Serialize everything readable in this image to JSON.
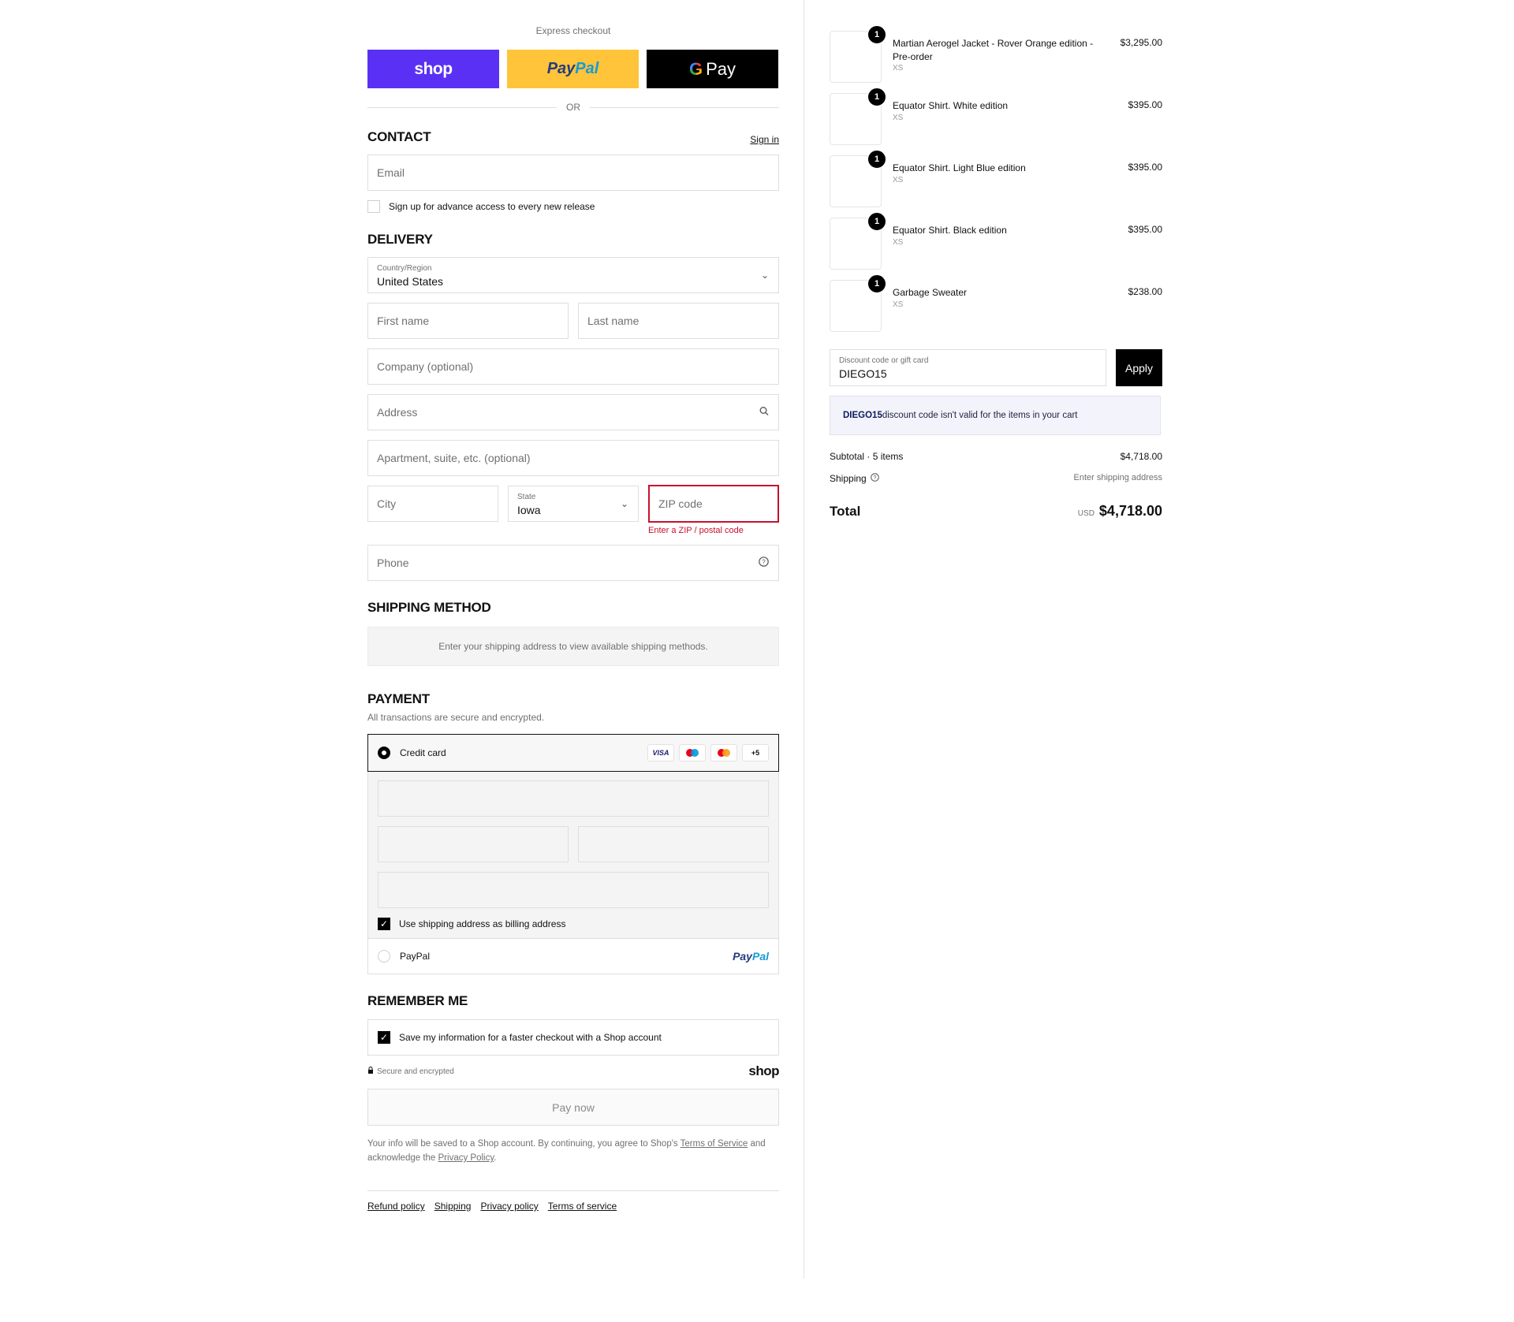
{
  "express": {
    "label": "Express checkout",
    "shop_label": "shop",
    "paypal_part1": "Pay",
    "paypal_part2": "Pal",
    "gpay_g": "G",
    "gpay_label": "Pay",
    "or_label": "OR"
  },
  "contact": {
    "heading": "CONTACT",
    "sign_in": "Sign in",
    "email_placeholder": "Email",
    "newsletter_label": "Sign up for advance access to every new release",
    "newsletter_checked": false
  },
  "delivery": {
    "heading": "DELIVERY",
    "country_label": "Country/Region",
    "country_value": "United States",
    "first_name_placeholder": "First name",
    "last_name_placeholder": "Last name",
    "company_placeholder": "Company (optional)",
    "address_placeholder": "Address",
    "apartment_placeholder": "Apartment, suite, etc. (optional)",
    "city_placeholder": "City",
    "state_label": "State",
    "state_value": "Iowa",
    "zip_placeholder": "ZIP code",
    "zip_error": "Enter a ZIP / postal code",
    "phone_placeholder": "Phone"
  },
  "shipping_method": {
    "heading": "SHIPPING METHOD",
    "notice": "Enter your shipping address to view available shipping methods."
  },
  "payment": {
    "heading": "PAYMENT",
    "subtitle": "All transactions are secure and encrypted.",
    "credit_card_label": "Credit card",
    "card_badges": [
      "VISA",
      "maestro",
      "mastercard",
      "+5"
    ],
    "billing_same_label": "Use shipping address as billing address",
    "billing_same_checked": true,
    "paypal_label": "PayPal",
    "paypal_logo_part1": "Pay",
    "paypal_logo_part2": "Pal"
  },
  "remember": {
    "heading": "REMEMBER ME",
    "save_label": "Save my information for a faster checkout with a Shop account",
    "save_checked": true,
    "secure_label": "Secure and encrypted",
    "shop_logo": "shop"
  },
  "pay_now_label": "Pay now",
  "legal": {
    "text_before": "Your info will be saved to a Shop account. By continuing, you agree to Shop's ",
    "terms_link": "Terms of Service",
    "text_middle": " and acknowledge the ",
    "privacy_link": "Privacy Policy",
    "text_after": "."
  },
  "footer_links": [
    "Refund policy",
    "Shipping",
    "Privacy policy",
    "Terms of service"
  ],
  "cart": {
    "items": [
      {
        "name": "Martian Aerogel Jacket - Rover Orange edition - Pre-order",
        "variant": "XS",
        "price": "$3,295.00",
        "qty": "1",
        "thumb_color": "#e04a1a",
        "thumb_bg": "#1a1a1a"
      },
      {
        "name": "Equator Shirt. White edition",
        "variant": "XS",
        "price": "$395.00",
        "qty": "1",
        "thumb_color": "#f4f4f4",
        "thumb_bg": "#e9e9e9"
      },
      {
        "name": "Equator Shirt. Light Blue edition",
        "variant": "XS",
        "price": "$395.00",
        "qty": "1",
        "thumb_color": "#a9c3dc",
        "thumb_bg": "#dcdcdc"
      },
      {
        "name": "Equator Shirt. Black edition",
        "variant": "XS",
        "price": "$395.00",
        "qty": "1",
        "thumb_color": "#1b1b1b",
        "thumb_bg": "#d8d8d8"
      },
      {
        "name": "Garbage Sweater",
        "variant": "XS",
        "price": "$238.00",
        "qty": "1",
        "thumb_color": "#4c5446",
        "thumb_bg": "#0f0f0f"
      }
    ],
    "discount_label": "Discount code or gift card",
    "discount_value": "DIEGO15",
    "apply_label": "Apply",
    "discount_error_code": "DIEGO15",
    "discount_error_text": " discount code isn't valid for the items in your cart",
    "subtotal_label": "Subtotal · 5 items",
    "subtotal_value": "$4,718.00",
    "shipping_label": "Shipping",
    "shipping_value": "Enter shipping address",
    "total_label": "Total",
    "currency": "USD",
    "total_value": "$4,718.00"
  },
  "colors": {
    "shop_purple": "#5a31f4",
    "paypal_yellow": "#ffc439",
    "error_red": "#c8102e",
    "discount_notice_bg": "#f3f4fb"
  }
}
